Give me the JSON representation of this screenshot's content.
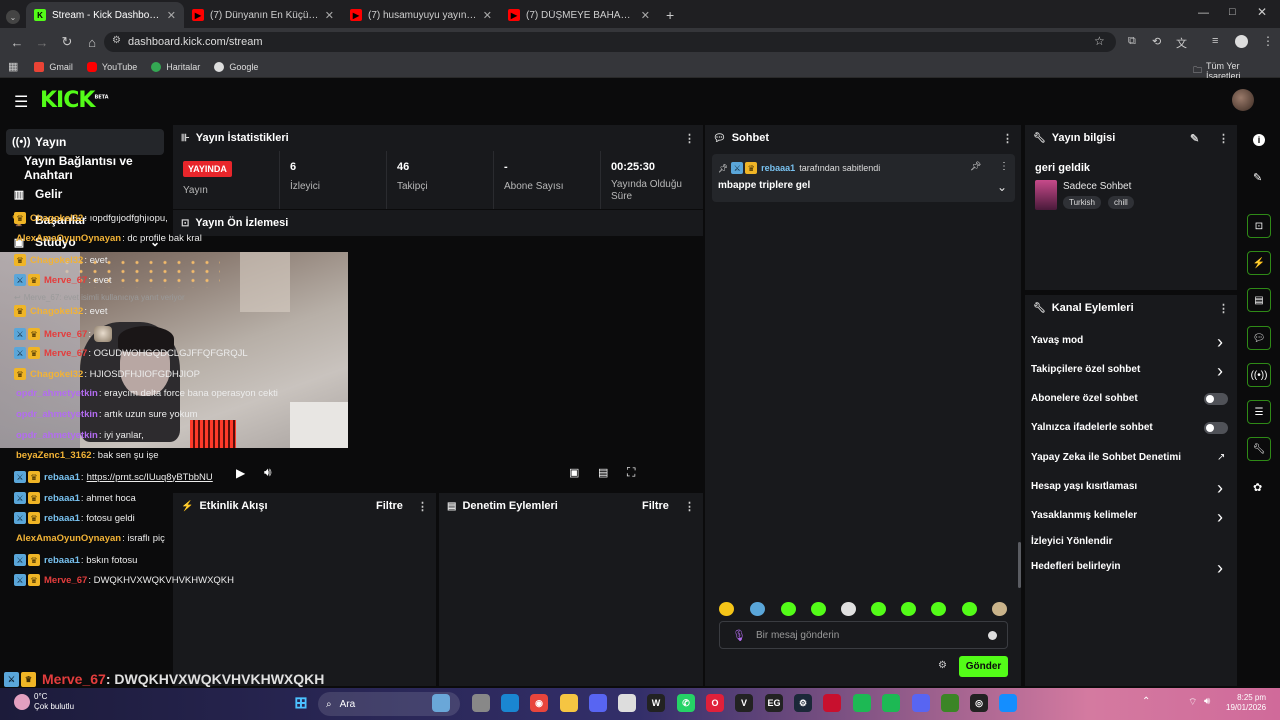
{
  "browser": {
    "tabs": [
      {
        "label": "Stream - Kick Dashboard",
        "icon": "kick-icon",
        "color": "#53fc18"
      },
      {
        "label": "(7) Dünyanın En Küçük Evleri !",
        "icon": "youtube-icon",
        "color": "#ff0000"
      },
      {
        "label": "(7) husamuyuyu yayın vakti 14 -",
        "icon": "youtube-icon",
        "color": "#ff0000"
      },
      {
        "label": "(7) DÜŞMEYE BAHANE ARAMA",
        "icon": "youtube-icon",
        "color": "#ff0000"
      }
    ],
    "url": "dashboard.kick.com/stream",
    "bookmarks": [
      "Gmail",
      "YouTube",
      "Haritalar",
      "Google"
    ],
    "all_bookmarks": "Tüm Yer İşaretleri"
  },
  "sidebar": {
    "items": [
      {
        "label": "Yayın",
        "icon": "broadcast-icon"
      },
      {
        "label": "Yayın Bağlantısı ve Anahtarı",
        "icon": ""
      },
      {
        "label": "Gelir",
        "icon": "chart-icon"
      },
      {
        "label": "Başarılar",
        "icon": "trophy-icon"
      },
      {
        "label": "Stüdyo",
        "icon": "studio-icon"
      }
    ]
  },
  "stats": {
    "title": "Yayın İstatistikleri",
    "live_badge": "YAYINDA",
    "items": [
      {
        "value": "",
        "label": "Yayın"
      },
      {
        "value": "6",
        "label": "İzleyici"
      },
      {
        "value": "46",
        "label": "Takipçi"
      },
      {
        "value": "-",
        "label": "Abone Sayısı"
      },
      {
        "value": "00:25:30",
        "label": "Yayında Olduğu Süre"
      }
    ]
  },
  "preview": {
    "title": "Yayın Ön İzlemesi"
  },
  "activity": {
    "title": "Etkinlik Akışı",
    "filter": "Filtre"
  },
  "moderation": {
    "title": "Denetim Eylemleri",
    "filter": "Filtre"
  },
  "chat": {
    "title": "Sohbet",
    "pinned_by": "rebaaa1",
    "pinned_suffix": "tarafından sabitlendi",
    "pinned_text": "mbappe triplere gel",
    "messages": [
      {
        "user": "Chagokel32",
        "color": "gold",
        "badges": [
          "sub"
        ],
        "text": ": ıopdfgıjodfghjıopu,"
      },
      {
        "user": "AlexAmaOyunOynayan",
        "color": "gold",
        "badges": [],
        "text": ": dc profile bak kral"
      },
      {
        "user": "Chagokel32",
        "color": "gold",
        "badges": [
          "sub"
        ],
        "text": ": evet"
      },
      {
        "user": "Merve_67",
        "color": "red",
        "badges": [
          "mod",
          "sub"
        ],
        "text": ": evet"
      },
      {
        "user": "Chagokel32",
        "color": "gold",
        "badges": [
          "sub"
        ],
        "text": ": evet",
        "reply": "Merve_67: evet isimli kullanıcıya yanıt veriyor"
      },
      {
        "user": "Merve_67",
        "color": "red",
        "badges": [
          "mod",
          "sub"
        ],
        "text": ":",
        "emote": true
      },
      {
        "user": "Merve_67",
        "color": "red",
        "badges": [
          "mod",
          "sub"
        ],
        "text": ": OGUDWOHGQDCLGJFFQFGRQJL"
      },
      {
        "user": "Chagokel32",
        "color": "gold",
        "badges": [
          "sub"
        ],
        "text": ": HJIOSDFHJIOFGDHJIOP"
      },
      {
        "user": "opdr_ahmetyetkin",
        "color": "purple",
        "badges": [],
        "text": ": eraycım delta force bana operasyon cekti"
      },
      {
        "user": "opdr_ahmetyetkin",
        "color": "purple",
        "badges": [],
        "text": ": artık uzun sure yokum"
      },
      {
        "user": "opdr_ahmetyetkin",
        "color": "purple",
        "badges": [],
        "text": ": iyi yanlar,"
      },
      {
        "user": "beyaZenc1_3162",
        "color": "gold",
        "badges": [],
        "text": ": bak sen şu işe"
      },
      {
        "user": "rebaaa1",
        "color": "blue",
        "badges": [
          "mod",
          "sub"
        ],
        "text": ":",
        "link": "https://prnt.sc/IUuq8yBTbbNU"
      },
      {
        "user": "rebaaa1",
        "color": "blue",
        "badges": [
          "mod",
          "sub"
        ],
        "text": ": ahmet hoca"
      },
      {
        "user": "rebaaa1",
        "color": "blue",
        "badges": [
          "mod",
          "sub"
        ],
        "text": ": fotosu geldi"
      },
      {
        "user": "AlexAmaOyunOynayan",
        "color": "gold",
        "badges": [],
        "text": ": israflı piç"
      },
      {
        "user": "rebaaa1",
        "color": "blue",
        "badges": [
          "mod",
          "sub"
        ],
        "text": ": bskın fotosu"
      },
      {
        "user": "Merve_67",
        "color": "red",
        "badges": [
          "mod",
          "sub"
        ],
        "text": ": DWQKHVXWQKVHVKHWXQKH"
      }
    ],
    "input_placeholder": "Bir mesaj gönderin",
    "send_label": "Gönder"
  },
  "stream_info": {
    "title": "Yayın bilgisi",
    "stream_title": "geri geldik",
    "category": "Sadece Sohbet",
    "tags": [
      "Turkish",
      "chill"
    ]
  },
  "channel_actions": {
    "title": "Kanal Eylemleri",
    "items": [
      {
        "label": "Yavaş mod",
        "control": "chevron"
      },
      {
        "label": "Takipçilere özel sohbet",
        "control": "chevron"
      },
      {
        "label": "Abonelere özel sohbet",
        "control": "toggle",
        "on": false
      },
      {
        "label": "Yalnızca ifadelerle sohbet",
        "control": "toggle",
        "on": false
      },
      {
        "label": "Yapay Zeka ile Sohbet Denetimi",
        "control": "external"
      },
      {
        "label": "Hesap yaşı kısıtlaması",
        "control": "chevron"
      },
      {
        "label": "Yasaklanmış kelimeler",
        "control": "chevron"
      },
      {
        "label": "İzleyici Yönlendir",
        "control": "none"
      },
      {
        "label": "Hedefleri belirleyin",
        "control": "chevron"
      }
    ]
  },
  "overlay_text": {
    "user": "Merve_67",
    "text": ": DWQKHVXWQKVHVKHWXQKH"
  },
  "taskbar": {
    "weather_temp": "0°C",
    "weather_desc": "Çok bulutlu",
    "search": "Ara",
    "time": "8:25 pm",
    "date": "19/01/2026"
  }
}
